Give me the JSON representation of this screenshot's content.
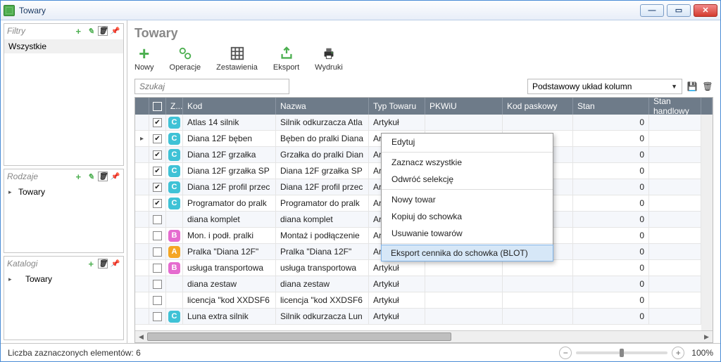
{
  "window": {
    "title": "Towary"
  },
  "left": {
    "filtry": {
      "label": "Filtry",
      "item": "Wszystkie"
    },
    "rodzaje": {
      "label": "Rodzaje",
      "item": "Towary"
    },
    "katalogi": {
      "label": "Katalogi",
      "item": "Towary"
    }
  },
  "main": {
    "title": "Towary",
    "toolbar": {
      "nowy": "Nowy",
      "operacje": "Operacje",
      "zestawienia": "Zestawienia",
      "eksport": "Eksport",
      "wydruki": "Wydruki"
    },
    "search_placeholder": "Szukaj",
    "layout_label": "Podstawowy układ kolumn",
    "columns": {
      "z": "Z...",
      "kod": "Kod",
      "nazwa": "Nazwa",
      "typ": "Typ Towaru",
      "pkwiu": "PKWiU",
      "kodp": "Kod paskowy",
      "stan": "Stan",
      "stanh": "Stan handlowy"
    },
    "rows": [
      {
        "checked": true,
        "cat": "C",
        "kod": "Atlas 14 silnik",
        "nazwa": "Silnik odkurzacza Atla",
        "typ": "Artykuł",
        "stan": "0",
        "mark": ""
      },
      {
        "checked": true,
        "cat": "C",
        "kod": "Diana 12F bęben",
        "nazwa": "Bęben do pralki Diana",
        "typ": "Artykuł",
        "stan": "0",
        "mark": "▸"
      },
      {
        "checked": true,
        "cat": "C",
        "kod": "Diana 12F grzałka",
        "nazwa": "Grzałka do pralki Dian",
        "typ": "Artykuł",
        "stan": "0",
        "mark": ""
      },
      {
        "checked": true,
        "cat": "C",
        "kod": "Diana 12F grzałka SP",
        "nazwa": "Diana 12F grzałka SP",
        "typ": "Artykuł",
        "stan": "0",
        "mark": ""
      },
      {
        "checked": true,
        "cat": "C",
        "kod": "Diana 12F profil przec",
        "nazwa": "Diana 12F profil przec",
        "typ": "Artykuł",
        "stan": "0",
        "mark": ""
      },
      {
        "checked": true,
        "cat": "C",
        "kod": "Programator do pralk",
        "nazwa": "Programator do pralk",
        "typ": "Artykuł",
        "stan": "0",
        "mark": ""
      },
      {
        "checked": false,
        "cat": "",
        "kod": "diana komplet",
        "nazwa": "diana komplet",
        "typ": "Artykuł",
        "stan": "0",
        "mark": ""
      },
      {
        "checked": false,
        "cat": "B",
        "kod": "Mon. i podł. pralki",
        "nazwa": "Montaż i podłączenie",
        "typ": "Artykuł",
        "stan": "0",
        "mark": ""
      },
      {
        "checked": false,
        "cat": "A",
        "kod": "Pralka \"Diana 12F\"",
        "nazwa": "Pralka \"Diana 12F\"",
        "typ": "Artykuł",
        "stan": "0",
        "mark": ""
      },
      {
        "checked": false,
        "cat": "B",
        "kod": "usługa transportowa",
        "nazwa": "usługa transportowa",
        "typ": "Artykuł",
        "stan": "0",
        "mark": ""
      },
      {
        "checked": false,
        "cat": "",
        "kod": "diana zestaw",
        "nazwa": "diana zestaw",
        "typ": "Artykuł",
        "stan": "0",
        "mark": ""
      },
      {
        "checked": false,
        "cat": "",
        "kod": "licencja \"kod XXDSF6",
        "nazwa": "licencja \"kod XXDSF6",
        "typ": "Artykuł",
        "stan": "0",
        "mark": ""
      },
      {
        "checked": false,
        "cat": "C",
        "kod": "Luna extra silnik",
        "nazwa": "Silnik odkurzacza Lun",
        "typ": "Artykuł",
        "stan": "0",
        "mark": ""
      }
    ]
  },
  "context_menu": {
    "edytuj": "Edytuj",
    "zaznacz": "Zaznacz wszystkie",
    "odwroc": "Odwróć selekcję",
    "nowy": "Nowy towar",
    "kopiuj": "Kopiuj do schowka",
    "usuwanie": "Usuwanie towarów",
    "eksport": "Eksport cennika do schowka (BLOT)"
  },
  "status": {
    "selected_label": "Liczba zaznaczonych elementów: 6",
    "zoom": "100%"
  }
}
